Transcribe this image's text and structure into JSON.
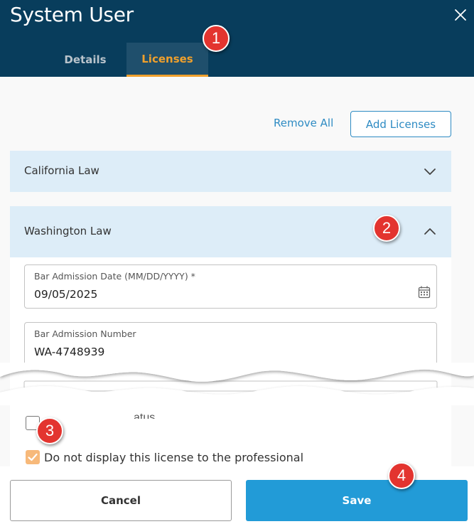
{
  "dialog": {
    "title": "System User",
    "tabs": [
      {
        "label": "Details",
        "active": false
      },
      {
        "label": "Licenses",
        "active": true
      }
    ]
  },
  "actions": {
    "remove_all": "Remove All",
    "add_licenses": "Add Licenses"
  },
  "licenses": [
    {
      "name": "California Law",
      "expanded": false
    },
    {
      "name": "Washington Law",
      "expanded": true
    }
  ],
  "fields": {
    "bar_date": {
      "label": "Bar Admission Date (MM/DD/YYYY) *",
      "value": "09/05/2025"
    },
    "bar_number": {
      "label": "Bar Admission Number",
      "value": "WA-4748939"
    }
  },
  "checkboxes": {
    "partial_label": "atus",
    "hide_license": {
      "label": "Do not display this license to the professional",
      "checked": true
    }
  },
  "footer": {
    "cancel": "Cancel",
    "save": "Save"
  },
  "callouts": [
    "1",
    "2",
    "3",
    "4"
  ],
  "colors": {
    "header_bg": "#083d5c",
    "accent_orange": "#f0a02c",
    "link_blue": "#2e8bc3",
    "save_blue": "#229bd7",
    "accordion_bg": "#ddedf8",
    "callout_red": "#e3342f"
  },
  "icons": {
    "close": "close-icon",
    "chevron_down": "chevron-down-icon",
    "chevron_up": "chevron-up-icon",
    "calendar": "calendar-icon",
    "check": "check-icon"
  }
}
